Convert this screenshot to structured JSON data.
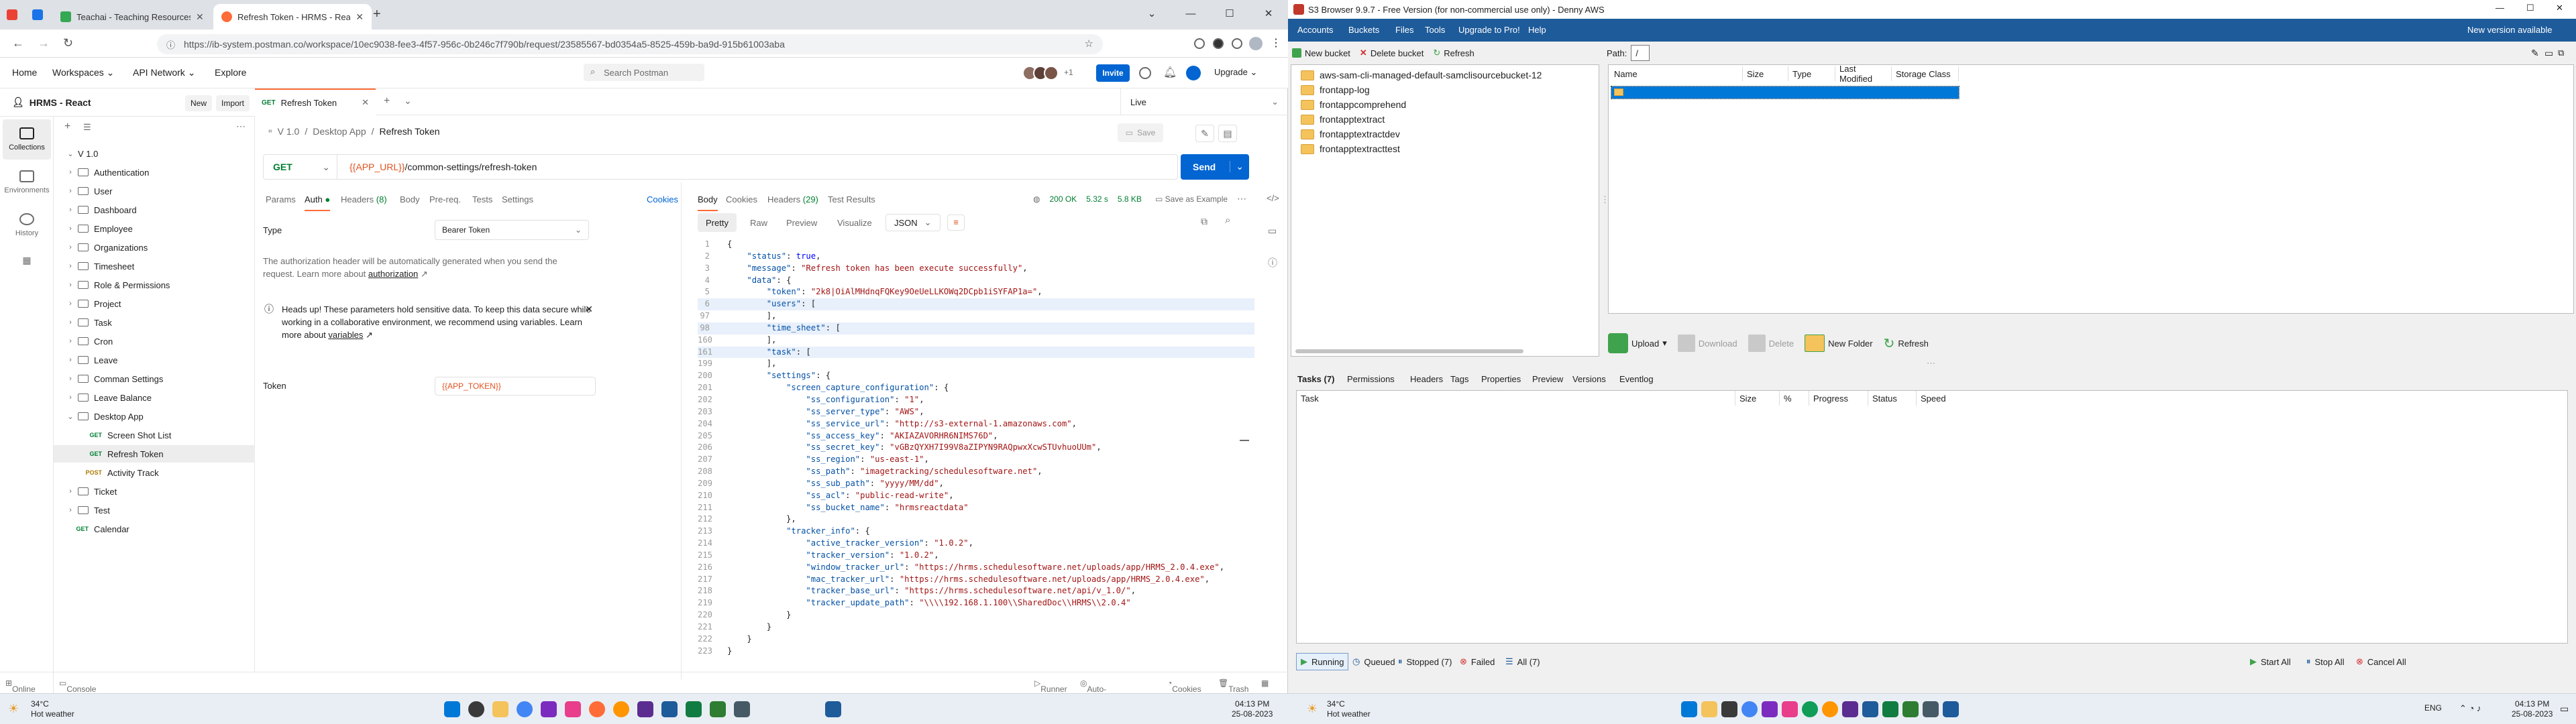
{
  "browser": {
    "tabs": [
      {
        "title": "Teachai - Teaching Resources Maki",
        "color": "#34a853"
      },
      {
        "title": "Refresh Token - HRMS - React",
        "color": "#ff6c37"
      }
    ],
    "url": "https://ib-system.postman.co/workspace/10ec9038-fee3-4f57-956c-0b246c7f790b/request/23585567-bd0354a5-8525-459b-ba9d-915b61003aba"
  },
  "postman": {
    "nav": [
      "Home",
      "Workspaces",
      "API Network",
      "Explore"
    ],
    "search": "Search Postman",
    "avatars_more": "+1",
    "invite": "Invite",
    "upgrade": "Upgrade",
    "workspace": "HRMS - React",
    "new": "New",
    "import": "Import",
    "rail": [
      "Collections",
      "Environments",
      "History"
    ],
    "collection": "V 1.0",
    "tree": [
      {
        "type": "folder",
        "label": "Authentication"
      },
      {
        "type": "folder",
        "label": "User"
      },
      {
        "type": "folder",
        "label": "Dashboard"
      },
      {
        "type": "folder",
        "label": "Employee"
      },
      {
        "type": "folder",
        "label": "Organizations"
      },
      {
        "type": "folder",
        "label": "Timesheet"
      },
      {
        "type": "folder",
        "label": "Role & Permissions"
      },
      {
        "type": "folder",
        "label": "Project"
      },
      {
        "type": "folder",
        "label": "Task"
      },
      {
        "type": "folder",
        "label": "Cron"
      },
      {
        "type": "folder",
        "label": "Leave"
      },
      {
        "type": "folder",
        "label": "Comman Settings"
      },
      {
        "type": "folder",
        "label": "Leave Balance"
      },
      {
        "type": "folder-open",
        "label": "Desktop App"
      },
      {
        "type": "request",
        "method": "GET",
        "label": "Screen Shot List"
      },
      {
        "type": "request",
        "method": "GET",
        "label": "Refresh Token",
        "selected": true
      },
      {
        "type": "request",
        "method": "POST",
        "label": "Activity Track"
      },
      {
        "type": "folder",
        "label": "Ticket"
      },
      {
        "type": "folder",
        "label": "Test"
      },
      {
        "type": "request",
        "method": "GET",
        "label": "Calendar",
        "root": true
      }
    ],
    "request_tab": {
      "method": "GET",
      "title": "Refresh Token"
    },
    "env": "Live",
    "breadcrumb": [
      "V 1.0",
      "Desktop App",
      "Refresh Token"
    ],
    "save": "Save",
    "method": "GET",
    "url_var": "{{APP_URL}}",
    "url_path": "/common-settings/refresh-token",
    "send": "Send",
    "req_tabs": [
      "Params",
      "Auth",
      "Headers",
      "(8)",
      "Body",
      "Pre-req.",
      "Tests",
      "Settings"
    ],
    "cookies": "Cookies",
    "auth_type_label": "Type",
    "auth_type_value": "Bearer Token",
    "auth_help": "The authorization header will be automatically generated when you send the request. Learn more about",
    "auth_link": "authorization",
    "heads_up": "Heads up! These parameters hold sensitive data. To keep this data secure while working in a collaborative environment, we recommend using variables. Learn more about",
    "heads_up_link": "variables",
    "token_label": "Token",
    "token_value": "{{APP_TOKEN}}",
    "resp_tabs": [
      "Body",
      "Cookies",
      "Headers",
      "(29)",
      "Test Results"
    ],
    "status": "200 OK",
    "time": "5.32 s",
    "size": "5.8 KB",
    "save_example": "Save as Example",
    "formats": [
      "Pretty",
      "Raw",
      "Preview",
      "Visualize",
      "JSON"
    ],
    "code": [
      {
        "n": "1",
        "t": [
          [
            "p",
            "{"
          ]
        ]
      },
      {
        "n": "2",
        "t": [
          [
            "p",
            "    "
          ],
          [
            "k",
            "\"status\""
          ],
          [
            "p",
            ": "
          ],
          [
            "b",
            "true"
          ],
          [
            "p",
            ","
          ]
        ]
      },
      {
        "n": "3",
        "t": [
          [
            "p",
            "    "
          ],
          [
            "k",
            "\"message\""
          ],
          [
            "p",
            ": "
          ],
          [
            "s",
            "\"Refresh token has been execute successfully\""
          ],
          [
            "p",
            ","
          ]
        ]
      },
      {
        "n": "4",
        "t": [
          [
            "p",
            "    "
          ],
          [
            "k",
            "\"data\""
          ],
          [
            "p",
            ": {"
          ]
        ]
      },
      {
        "n": "5",
        "t": [
          [
            "p",
            "        "
          ],
          [
            "k",
            "\"token\""
          ],
          [
            "p",
            ": "
          ],
          [
            "s",
            "\"2k8|OiAlMHdnqFQKey9OeUeLLKOWq2DCpb1iSYFAP1a=\""
          ],
          [
            "p",
            ","
          ]
        ]
      },
      {
        "n": "6",
        "t": [
          [
            "p",
            "        "
          ],
          [
            "k",
            "\"users\""
          ],
          [
            "p",
            ": ["
          ]
        ],
        "hl": true
      },
      {
        "n": "97",
        "t": [
          [
            "p",
            "        ],"
          ]
        ]
      },
      {
        "n": "98",
        "t": [
          [
            "p",
            "        "
          ],
          [
            "k",
            "\"time_sheet\""
          ],
          [
            "p",
            ": ["
          ]
        ],
        "hl": true
      },
      {
        "n": "160",
        "t": [
          [
            "p",
            "        ],"
          ]
        ]
      },
      {
        "n": "161",
        "t": [
          [
            "p",
            "        "
          ],
          [
            "k",
            "\"task\""
          ],
          [
            "p",
            ": ["
          ]
        ],
        "hl": true
      },
      {
        "n": "199",
        "t": [
          [
            "p",
            "        ],"
          ]
        ]
      },
      {
        "n": "200",
        "t": [
          [
            "p",
            "        "
          ],
          [
            "k",
            "\"settings\""
          ],
          [
            "p",
            ": {"
          ]
        ]
      },
      {
        "n": "201",
        "t": [
          [
            "p",
            "            "
          ],
          [
            "k",
            "\"screen_capture_configuration\""
          ],
          [
            "p",
            ": {"
          ]
        ]
      },
      {
        "n": "202",
        "t": [
          [
            "p",
            "                "
          ],
          [
            "k",
            "\"ss_configuration\""
          ],
          [
            "p",
            ": "
          ],
          [
            "s",
            "\"1\""
          ],
          [
            "p",
            ","
          ]
        ]
      },
      {
        "n": "203",
        "t": [
          [
            "p",
            "                "
          ],
          [
            "k",
            "\"ss_server_type\""
          ],
          [
            "p",
            ": "
          ],
          [
            "s",
            "\"AWS\""
          ],
          [
            "p",
            ","
          ]
        ]
      },
      {
        "n": "204",
        "t": [
          [
            "p",
            "                "
          ],
          [
            "k",
            "\"ss_service_url\""
          ],
          [
            "p",
            ": "
          ],
          [
            "s",
            "\"http://s3-external-1.amazonaws.com\""
          ],
          [
            "p",
            ","
          ]
        ]
      },
      {
        "n": "205",
        "t": [
          [
            "p",
            "                "
          ],
          [
            "k",
            "\"ss_access_key\""
          ],
          [
            "p",
            ": "
          ],
          [
            "s",
            "\"AKIAZAVORHR6NIMS76D\""
          ],
          [
            "p",
            ","
          ]
        ]
      },
      {
        "n": "206",
        "t": [
          [
            "p",
            "                "
          ],
          [
            "k",
            "\"ss_secret_key\""
          ],
          [
            "p",
            ": "
          ],
          [
            "s",
            "\"vGBzQYXH7I99V8aZIPYN9RAQpwxXcwSTUvhuoUUm\""
          ],
          [
            "p",
            ","
          ]
        ]
      },
      {
        "n": "207",
        "t": [
          [
            "p",
            "                "
          ],
          [
            "k",
            "\"ss_region\""
          ],
          [
            "p",
            ": "
          ],
          [
            "s",
            "\"us-east-1\""
          ],
          [
            "p",
            ","
          ]
        ]
      },
      {
        "n": "208",
        "t": [
          [
            "p",
            "                "
          ],
          [
            "k",
            "\"ss_path\""
          ],
          [
            "p",
            ": "
          ],
          [
            "s",
            "\"imagetracking/schedulesoftware.net\""
          ],
          [
            "p",
            ","
          ]
        ]
      },
      {
        "n": "209",
        "t": [
          [
            "p",
            "                "
          ],
          [
            "k",
            "\"ss_sub_path\""
          ],
          [
            "p",
            ": "
          ],
          [
            "s",
            "\"yyyy/MM/dd\""
          ],
          [
            "p",
            ","
          ]
        ]
      },
      {
        "n": "210",
        "t": [
          [
            "p",
            "                "
          ],
          [
            "k",
            "\"ss_acl\""
          ],
          [
            "p",
            ": "
          ],
          [
            "s",
            "\"public-read-write\""
          ],
          [
            "p",
            ","
          ]
        ]
      },
      {
        "n": "211",
        "t": [
          [
            "p",
            "                "
          ],
          [
            "k",
            "\"ss_bucket_name\""
          ],
          [
            "p",
            ": "
          ],
          [
            "s",
            "\"hrmsreactdata\""
          ]
        ]
      },
      {
        "n": "212",
        "t": [
          [
            "p",
            "            },"
          ]
        ]
      },
      {
        "n": "213",
        "t": [
          [
            "p",
            "            "
          ],
          [
            "k",
            "\"tracker_info\""
          ],
          [
            "p",
            ": {"
          ]
        ]
      },
      {
        "n": "214",
        "t": [
          [
            "p",
            "                "
          ],
          [
            "k",
            "\"active_tracker_version\""
          ],
          [
            "p",
            ": "
          ],
          [
            "s",
            "\"1.0.2\""
          ],
          [
            "p",
            ","
          ]
        ]
      },
      {
        "n": "215",
        "t": [
          [
            "p",
            "                "
          ],
          [
            "k",
            "\"tracker_version\""
          ],
          [
            "p",
            ": "
          ],
          [
            "s",
            "\"1.0.2\""
          ],
          [
            "p",
            ","
          ]
        ]
      },
      {
        "n": "216",
        "t": [
          [
            "p",
            "                "
          ],
          [
            "k",
            "\"window_tracker_url\""
          ],
          [
            "p",
            ": "
          ],
          [
            "s",
            "\"https://hrms.schedulesoftware.net/uploads/app/HRMS_2.0.4.exe\""
          ],
          [
            "p",
            ","
          ]
        ]
      },
      {
        "n": "217",
        "t": [
          [
            "p",
            "                "
          ],
          [
            "k",
            "\"mac_tracker_url\""
          ],
          [
            "p",
            ": "
          ],
          [
            "s",
            "\"https://hrms.schedulesoftware.net/uploads/app/HRMS_2.0.4.exe\""
          ],
          [
            "p",
            ","
          ]
        ]
      },
      {
        "n": "218",
        "t": [
          [
            "p",
            "                "
          ],
          [
            "k",
            "\"tracker_base_url\""
          ],
          [
            "p",
            ": "
          ],
          [
            "s",
            "\"https://hrms.schedulesoftware.net/api/v_1.0/\""
          ],
          [
            "p",
            ","
          ]
        ]
      },
      {
        "n": "219",
        "t": [
          [
            "p",
            "                "
          ],
          [
            "k",
            "\"tracker_update_path\""
          ],
          [
            "p",
            ": "
          ],
          [
            "s",
            "\"\\\\\\\\192.168.1.100\\\\SharedDoc\\\\HRMS\\\\2.0.4\""
          ]
        ]
      },
      {
        "n": "220",
        "t": [
          [
            "p",
            "            }"
          ]
        ]
      },
      {
        "n": "221",
        "t": [
          [
            "p",
            "        }"
          ]
        ]
      },
      {
        "n": "222",
        "t": [
          [
            "p",
            "    }"
          ]
        ]
      },
      {
        "n": "223",
        "t": [
          [
            "p",
            "}"
          ]
        ]
      }
    ],
    "statusbar": [
      "Online",
      "Console",
      "Runner",
      "Auto-select agent",
      "Cookies",
      "Trash"
    ]
  },
  "s3": {
    "title": "S3 Browser 9.9.7 - Free Version (for non-commercial use only) - Denny AWS",
    "menu": [
      "Accounts",
      "Buckets",
      "Files",
      "Tools",
      "Upgrade to Pro!",
      "Help"
    ],
    "new_version": "New version available",
    "toolbar": [
      "New bucket",
      "Delete bucket",
      "Refresh"
    ],
    "buckets": [
      "aws-sam-cli-managed-default-samclisourcebucket-12",
      "frontapp-log",
      "frontappcomprehend",
      "frontapptextract",
      "frontapptextractdev",
      "frontapptextracttest"
    ],
    "path_label": "Path:",
    "path_value": "/",
    "columns": [
      "Name",
      "Size",
      "Type",
      "Last Modified",
      "Storage Class"
    ],
    "file_toolbar": [
      "Upload",
      "Download",
      "Delete",
      "New Folder",
      "Refresh"
    ],
    "task_tabs": [
      "Tasks (7)",
      "Permissions",
      "Headers",
      "Tags",
      "Properties",
      "Preview",
      "Versions",
      "Eventlog"
    ],
    "task_columns": [
      "Task",
      "Size",
      "%",
      "Progress",
      "Status",
      "Speed"
    ],
    "task_filters": [
      "Running",
      "Queued",
      "Stopped (7)",
      "Failed",
      "All (7)"
    ],
    "task_actions": [
      "Start All",
      "Stop All",
      "Cancel All"
    ]
  },
  "taskbar_left": {
    "temp": "34°C",
    "weather": "Hot weather",
    "time": "04:13 PM",
    "date": "25-08-2023"
  },
  "taskbar_right": {
    "temp": "34°C",
    "weather": "Hot weather",
    "lang": "ENG",
    "time": "04:13 PM",
    "date": "25-08-2023"
  }
}
